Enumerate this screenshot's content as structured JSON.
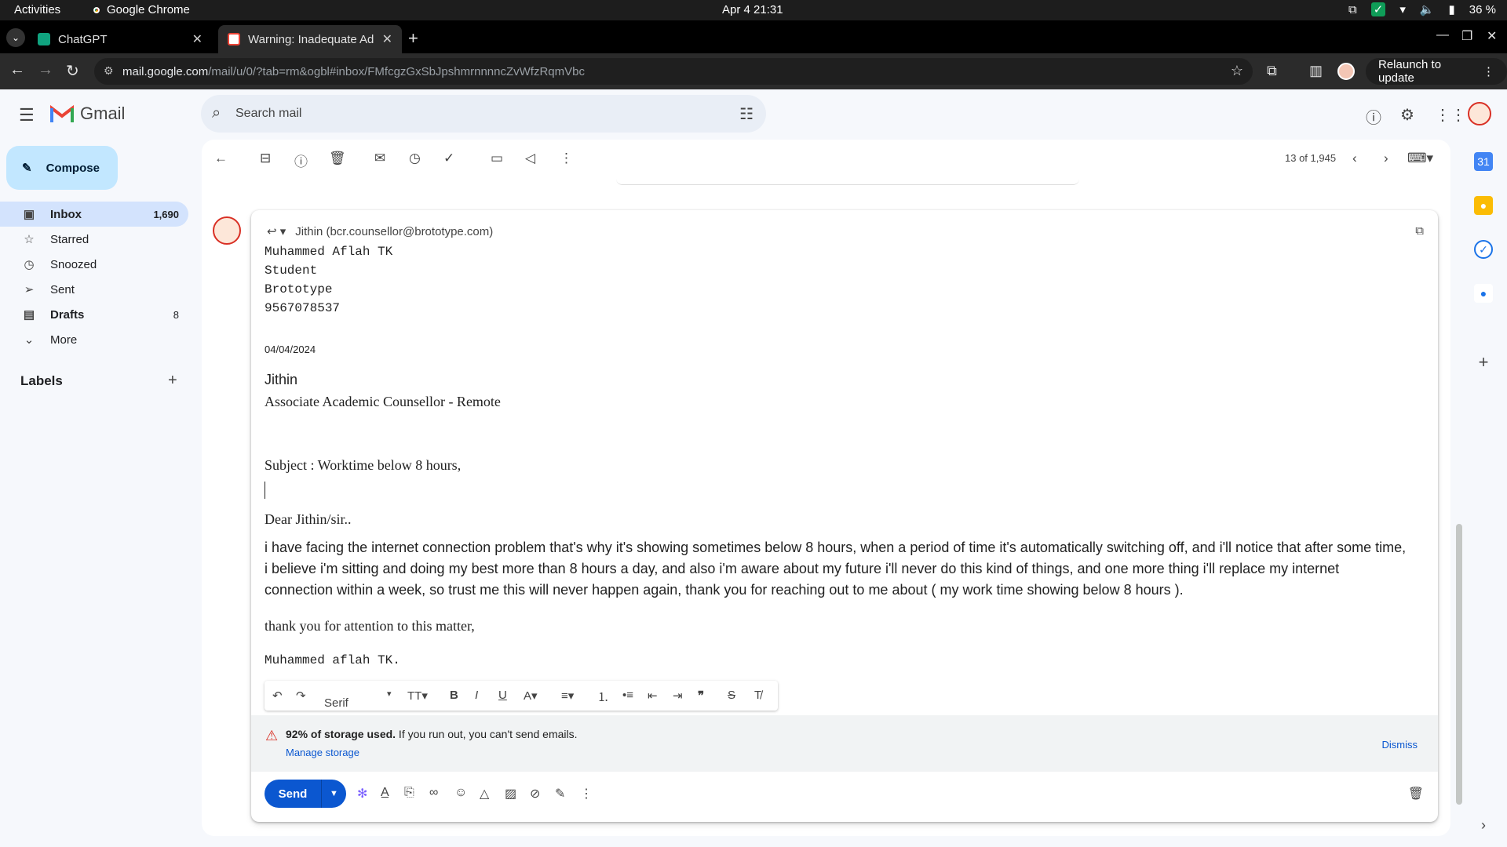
{
  "os": {
    "activities": "Activities",
    "app_name": "Google Chrome",
    "clock": "Apr 4  21:31",
    "battery": "36 %"
  },
  "browser": {
    "tabs": [
      {
        "title": "ChatGPT",
        "active": false
      },
      {
        "title": "Warning: Inadequate Ad",
        "active": true
      }
    ],
    "url_host": "mail.google.com",
    "url_path": "/mail/u/0/?tab=rm&ogbl#inbox/FMfcgzGxSbJpshmrnnnncZvWfzRqmVbc",
    "relaunch": "Relaunch to update"
  },
  "gmail": {
    "logo_text": "Gmail",
    "search_placeholder": "Search mail",
    "compose_label": "Compose",
    "nav": [
      {
        "label": "Inbox",
        "count": "1,690",
        "icon": "inbox-icon"
      },
      {
        "label": "Starred",
        "count": "",
        "icon": "star-icon"
      },
      {
        "label": "Snoozed",
        "count": "",
        "icon": "clock-icon"
      },
      {
        "label": "Sent",
        "count": "",
        "icon": "send-icon"
      },
      {
        "label": "Drafts",
        "count": "8",
        "icon": "draft-icon"
      },
      {
        "label": "More",
        "count": "",
        "icon": "chevron-down-icon"
      }
    ],
    "labels_header": "Labels",
    "pager": "13 of 1,945"
  },
  "compose": {
    "to": "Jithin (bcr.counsellor@brototype.com)",
    "sender_block": [
      "Muhammed Aflah TK",
      "Student",
      "Brototype",
      "9567078537"
    ],
    "date": "04/04/2024",
    "recipient_name": "Jithin",
    "recipient_title": "Associate Academic Counsellor - Remote",
    "subject": "Subject : Worktime below 8 hours,",
    "greeting": "Dear Jithin/sir..",
    "paragraph": "i have facing the internet connection problem that's why it's showing sometimes below 8 hours, when a period of time it's automatically switching off, and i'll notice that after some time, i believe i'm sitting and doing my best  more than 8 hours a day, and also i'm aware about my future i'll never do this kind of things, and one more thing i'll replace my internet connection within a week, so trust me this will never happen again, thank you for reaching out to me about ( my work time showing below 8 hours ).",
    "closing": "thank you for attention to this matter,",
    "signature": "Muhammed aflah TK.",
    "font_select": "Serif",
    "storage_bold": "92% of storage used.",
    "storage_rest": " If you run out, you can't send emails.",
    "manage_storage": "Manage storage",
    "dismiss": "Dismiss",
    "send": "Send"
  },
  "colors": {
    "accent": "#0b57d0",
    "compose_bg": "#c2e7ff",
    "selected_nav": "#d3e3fd"
  }
}
